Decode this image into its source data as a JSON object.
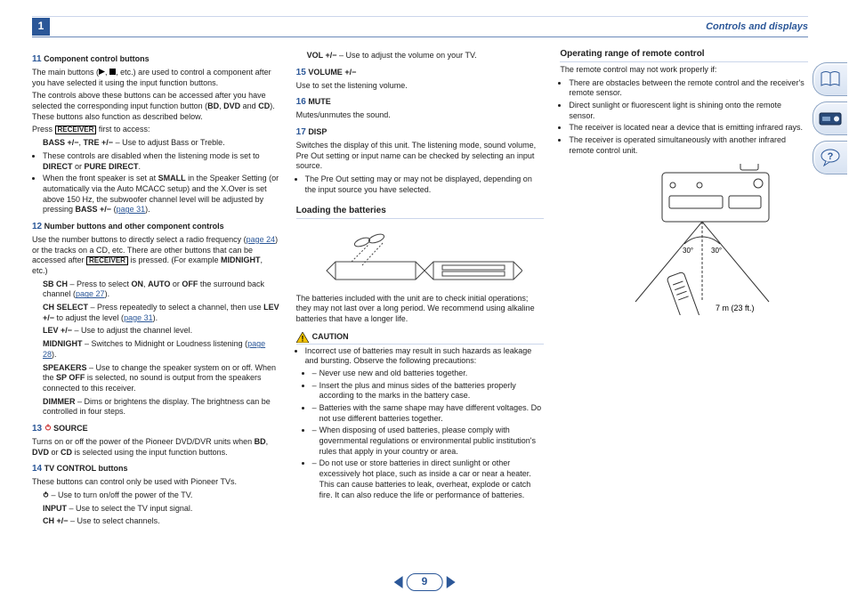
{
  "header": {
    "chapter_no": "1",
    "title": "Controls and displays"
  },
  "pager": {
    "page": "9"
  },
  "col1": {
    "i11": {
      "n": "11",
      "label": "Component control buttons",
      "p1_a": "The main buttons (",
      "p1_b": ",",
      "p1_c": ", etc.) are used to control a component after you have selected it using the input function buttons.",
      "p2_a": "The controls above these buttons can be accessed after you have selected the corresponding input function button (",
      "p2_bd": "BD",
      "p2_comma": ", ",
      "p2_dvd": "DVD",
      "p2_and": " and ",
      "p2_cd": "CD",
      "p2_b": "). These buttons also function as described below.",
      "p3_a": "Press ",
      "p3_btn": "RECEIVER",
      "p3_b": " first to access:",
      "bt": {
        "a": "BASS +/−",
        "c": ", ",
        "b": "TRE +/−",
        "d": " – Use to adjust Bass or Treble."
      },
      "b1_a": "These controls are disabled when the listening mode is set to ",
      "b1_d": "DIRECT",
      "b1_or": " or ",
      "b1_p": "PURE DIRECT",
      "b1_dot": ".",
      "b2_a": "When the front speaker is set at ",
      "b2_sm": "SMALL",
      "b2_b": " in the Speaker Setting (or automatically via the Auto MCACC setup) and the X.Over is set above 150 Hz, the subwoofer channel level will be adjusted by pressing ",
      "b2_bass": "BASS +/−",
      "b2_open": " (",
      "b2_link": "page 31",
      "b2_close": ")."
    },
    "i12": {
      "n": "12",
      "label": "Number buttons and other component controls",
      "p1_a": "Use the number buttons to directly select a radio frequency (",
      "p1_link": "page 24",
      "p1_b": ") or the tracks on a CD, etc. There are other buttons that can be accessed after ",
      "p1_btn": "RECEIVER",
      "p1_c": " is pressed. (For example ",
      "p1_mid": "MIDNIGHT",
      "p1_d": ", etc.)",
      "sb": {
        "a": "SB CH",
        "b": " – Press to select ",
        "on": "ON",
        "c": ", ",
        "auto": "AUTO",
        "d": " or ",
        "off": "OFF",
        "e": " the surround back channel (",
        "link": "page 27",
        "close": ")."
      },
      "ch": {
        "a": "CH SELECT",
        "b": " – Press repeatedly to select a channel, then use ",
        "lev": "LEV +/−",
        "c": " to adjust the level (",
        "link": "page 31",
        "close": ")."
      },
      "lev": {
        "a": "LEV +/−",
        "b": " – Use to adjust the channel level."
      },
      "mid": {
        "a": "MIDNIGHT",
        "b": " – Switches to Midnight or Loudness listening (",
        "link": "page 28",
        "close": ")."
      },
      "spk": {
        "a": "SPEAKERS",
        "b": " – Use to change the speaker system on or off. When the ",
        "sp": "SP OFF",
        "c": " is selected, no sound is output from the speakers connected to this receiver."
      },
      "dim": {
        "a": "DIMMER",
        "b": " – Dims or brightens the display. The brightness can be controlled in four steps."
      }
    },
    "i13": {
      "n": "13",
      "label": "SOURCE",
      "p": "Turns on or off the power of the Pioneer DVD/DVR units when ",
      "bd": "BD",
      "c1": ", ",
      "dvd": "DVD",
      "c2": " or ",
      "cd": "CD",
      "e": " is selected using the input function buttons."
    },
    "i14": {
      "n": "14",
      "label": "TV CONTROL buttons",
      "p": "These buttons can control only be used with Pioneer TVs.",
      "pw": " – Use to turn on/off the power of the TV.",
      "in": {
        "a": "INPUT",
        "b": " – Use to select the TV input signal."
      },
      "ch": {
        "a": "CH +/−",
        "b": " – Use to select channels."
      }
    }
  },
  "col2": {
    "vol": {
      "a": "VOL +/−",
      "b": " – Use to adjust the volume on your TV."
    },
    "i15": {
      "n": "15",
      "label": "VOLUME +/−",
      "p": "Use to set the listening volume."
    },
    "i16": {
      "n": "16",
      "label": "MUTE",
      "p": "Mutes/unmutes the sound."
    },
    "i17": {
      "n": "17",
      "label": "DISP",
      "p": "Switches the display of this unit. The listening mode, sound volume, Pre Out setting or input name can be checked by selecting an input source.",
      "b": "The Pre Out setting may or may not be displayed, depending on the input source you have selected."
    },
    "loading": {
      "title": "Loading the batteries",
      "p": "The batteries included with the unit are to check initial operations; they may not last over a long period. We recommend using alkaline batteries that have a longer life."
    },
    "caution": {
      "title": "CAUTION",
      "p": "Incorrect use of batteries may result in such hazards as leakage and bursting. Observe the following precautions:",
      "d1": "Never use new and old batteries together.",
      "d2": "Insert the plus and minus sides of the batteries properly according to the marks in the battery case.",
      "d3": "Batteries with the same shape may have different voltages. Do not use different batteries together.",
      "d4": "When disposing of used batteries, please comply with governmental regulations or environmental public institution's rules that apply in your country or area.",
      "d5": "Do not use or store batteries in direct sunlight or other excessively hot place, such as inside a car or near a heater. This can cause batteries to leak, overheat, explode or catch fire. It can also reduce the life or performance of batteries."
    }
  },
  "col3": {
    "range": {
      "title": "Operating range of remote control",
      "p": "The remote control may not work properly if:",
      "b1": "There are obstacles between the remote control and the receiver's remote sensor.",
      "b2": "Direct sunlight or fluorescent light is shining onto the remote sensor.",
      "b3": "The receiver is located near a device that is emitting infrared rays.",
      "b4": "The receiver is operated simultaneously with another infrared remote control unit.",
      "ang_l": "30°",
      "ang_r": "30°",
      "dist": "7 m (23 ft.)"
    }
  }
}
